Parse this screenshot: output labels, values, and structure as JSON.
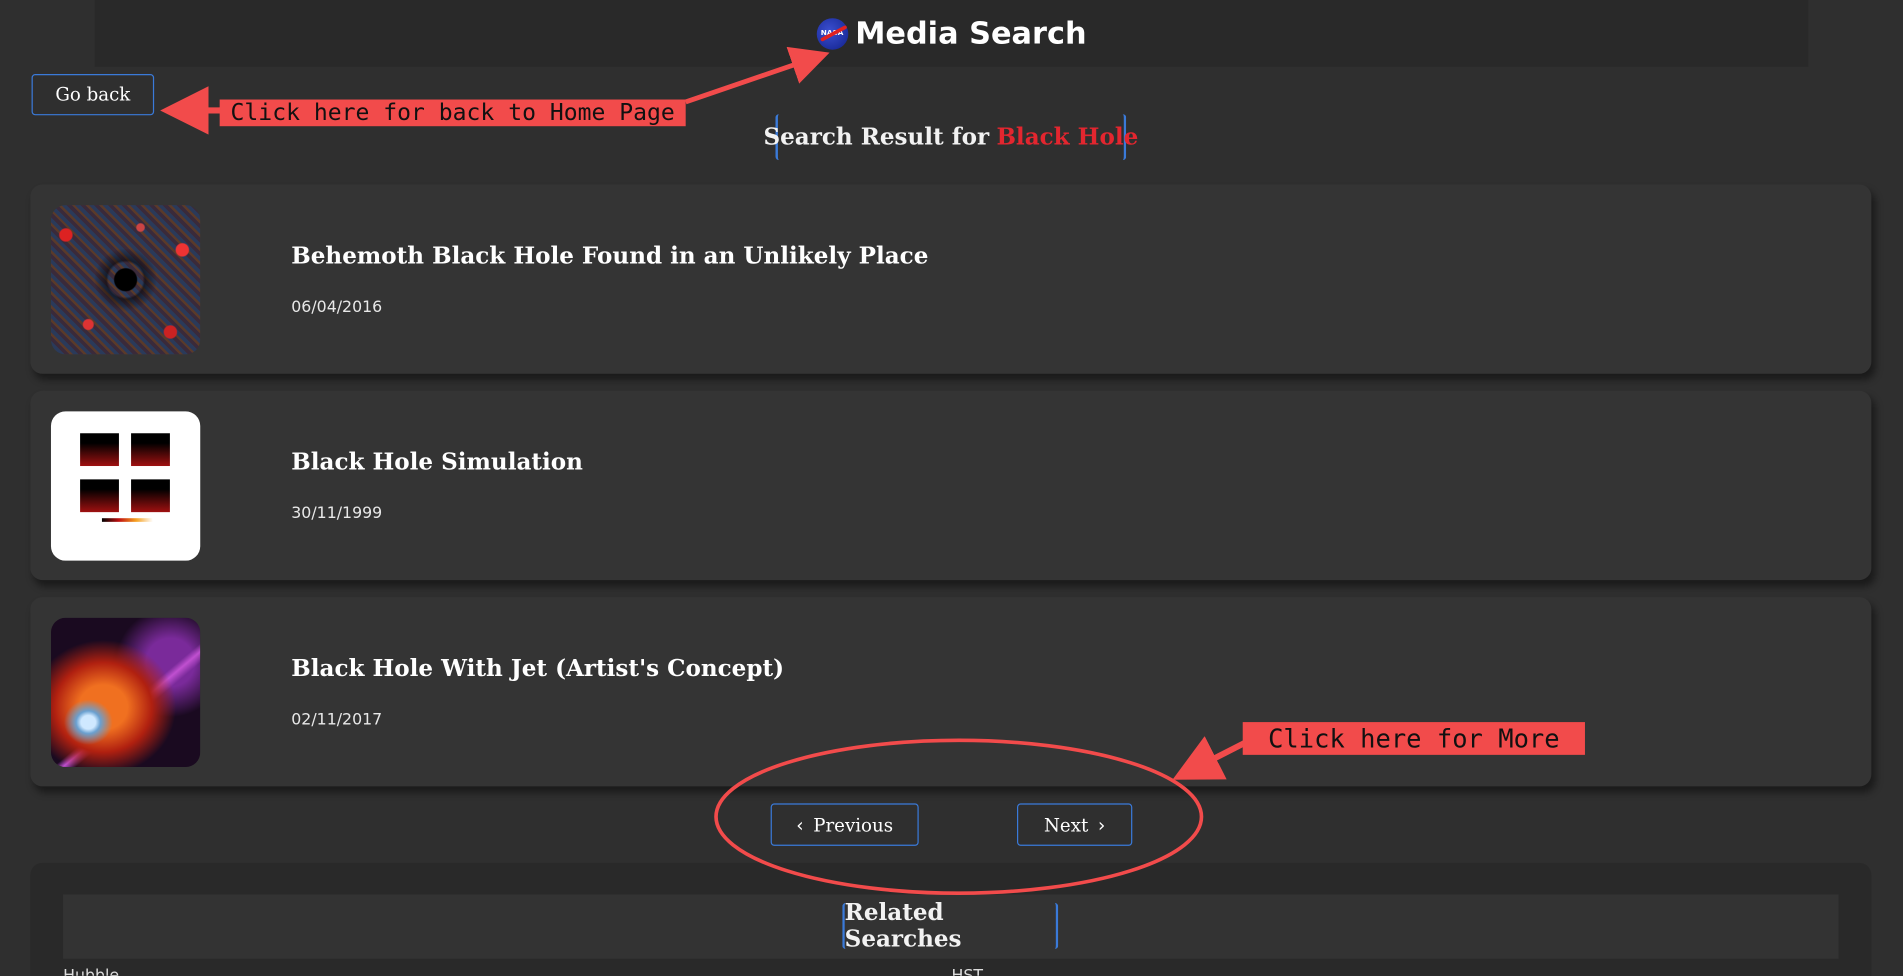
{
  "header": {
    "title": "Media Search",
    "logo_text": "NASA"
  },
  "nav": {
    "go_back_label": "Go back"
  },
  "annotations": {
    "home_note": "Click here for back to Home Page",
    "more_note": "Click here for More",
    "accent_color": "#f24b4b"
  },
  "search": {
    "prefix": "Search Result for",
    "query": "Black Hole",
    "query_color": "#e3262f"
  },
  "results": [
    {
      "title": "Behemoth Black Hole Found in an Unlikely Place",
      "date": "06/04/2016",
      "thumb": "galaxy-black-hole-image"
    },
    {
      "title": "Black Hole Simulation",
      "date": "30/11/1999",
      "thumb": "simulation-plots-image"
    },
    {
      "title": "Black Hole With Jet (Artist's Concept)",
      "date": "02/11/2017",
      "thumb": "black-hole-jet-image"
    }
  ],
  "pagination": {
    "previous_label": "Previous",
    "next_label": "Next",
    "prev_icon": "chevron-left-icon",
    "next_icon": "chevron-right-icon"
  },
  "related": {
    "title": "Related Searches",
    "items": [
      "Hubble",
      "HST"
    ]
  },
  "colors": {
    "background": "#2f2f2f",
    "card": "#343434",
    "button_border": "#3a7ad9"
  }
}
